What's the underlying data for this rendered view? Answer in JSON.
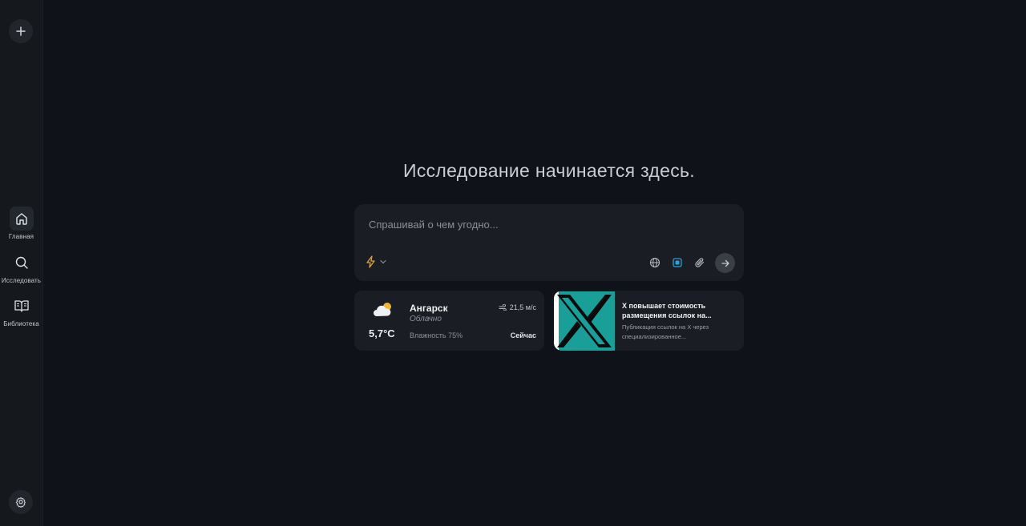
{
  "sidebar": {
    "new_thread": {
      "icon": "plus-icon"
    },
    "items": [
      {
        "label": "Главная",
        "icon": "home-icon",
        "active": true
      },
      {
        "label": "Исследовать",
        "icon": "search-icon",
        "active": false
      },
      {
        "label": "Библиотека",
        "icon": "book-icon",
        "active": false
      }
    ],
    "settings": {
      "icon": "gear-icon"
    }
  },
  "main": {
    "heading": "Исследование начинается здесь.",
    "composer": {
      "placeholder": "Спрашивай о чем угодно...",
      "value": "",
      "mode_icon": "lightning-icon",
      "tools": [
        "globe-icon",
        "focus-chip-icon",
        "paperclip-icon"
      ],
      "send_icon": "arrow-right-icon",
      "accent_color": "#e3a22e",
      "active_tool_color": "#2aa3d9"
    },
    "weather": {
      "icon": "partly-cloudy-icon",
      "temperature": "5,7°C",
      "city": "Ангарск",
      "condition": "Облачно",
      "humidity": "Влажность 75%",
      "wind": "21,5 м/с",
      "time": "Сейчас"
    },
    "news": {
      "thumbnail": "x-logo-image",
      "title": "X повышает стоимость размещения ссылок на...",
      "description": "Публикация ссылок на X через специализированное..."
    }
  },
  "colors": {
    "background": "#0f1218",
    "sidebar": "#15181d",
    "card": "#1a1d23",
    "thumbnail_teal": "#1a9e98"
  }
}
